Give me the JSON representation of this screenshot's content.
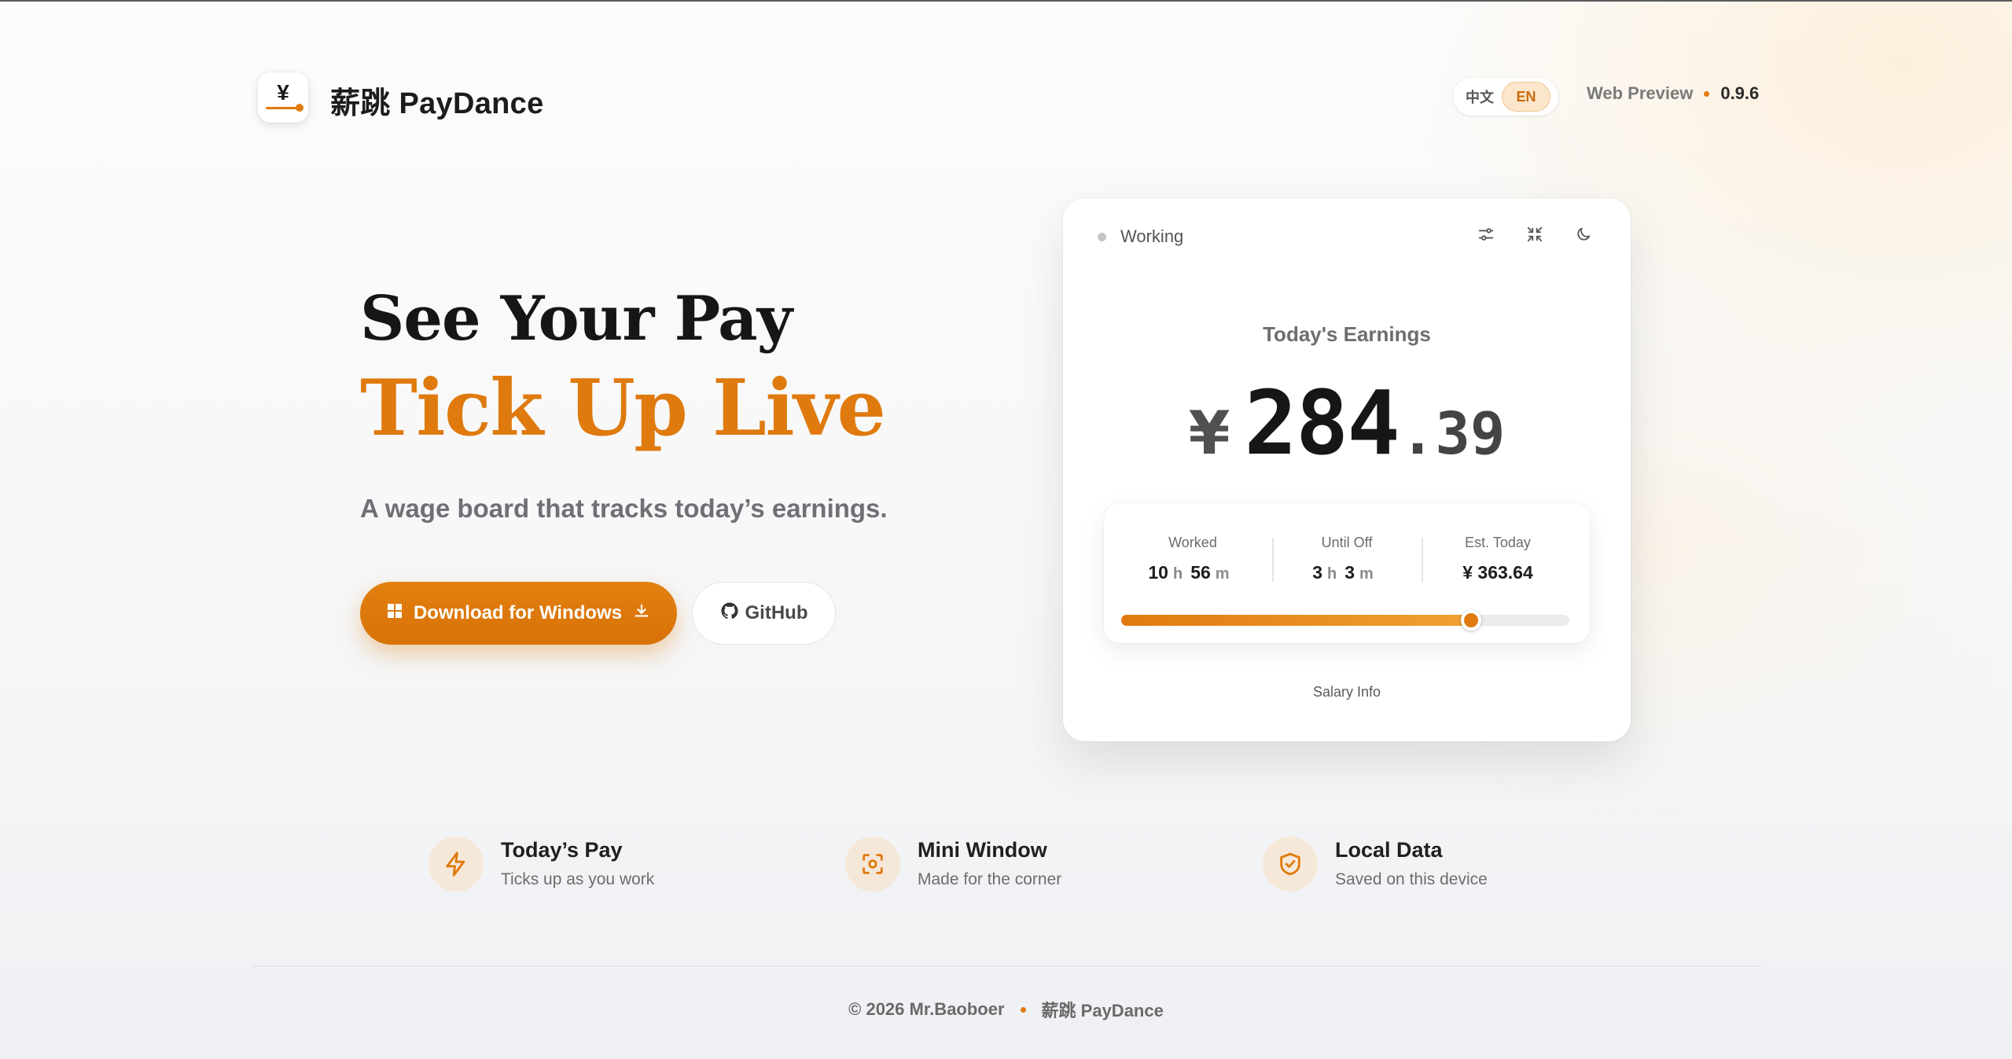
{
  "header": {
    "logo_glyph": "¥",
    "brand": "薪跳 PayDance",
    "lang_zh": "中文",
    "lang_en": "EN",
    "preview_label": "Web Preview",
    "version": "0.9.6"
  },
  "hero": {
    "line1": "See Your Pay",
    "line2": "Tick Up Live",
    "subtitle": "A wage board that tracks today’s earnings.",
    "download_label": "Download for Windows",
    "github_label": "GitHub"
  },
  "card": {
    "status": "Working",
    "earnings_title": "Today's Earnings",
    "currency": "¥",
    "amount_int": "284",
    "amount_dec": ".39",
    "stats": {
      "worked_label": "Worked",
      "worked_h": "10",
      "worked_m": "56",
      "until_label": "Until Off",
      "until_h": "3",
      "until_m": "3",
      "est_label": "Est. Today",
      "est_value": "¥ 363.64",
      "unit_h": "h",
      "unit_m": "m"
    },
    "progress_fraction": 0.78,
    "salary_link": "Salary Info"
  },
  "features": [
    {
      "title": "Today’s Pay",
      "desc": "Ticks up as you work",
      "icon": "lightning-icon"
    },
    {
      "title": "Mini Window",
      "desc": "Made for the corner",
      "icon": "focus-frame-icon"
    },
    {
      "title": "Local Data",
      "desc": "Saved on this device",
      "icon": "shield-check-icon"
    }
  ],
  "footer": {
    "copyright": "© 2026 Mr.Baoboer",
    "brand": "薪跳 PayDance"
  },
  "colors": {
    "accent": "#df7a0e",
    "accent_soft": "#fbe6cc"
  }
}
